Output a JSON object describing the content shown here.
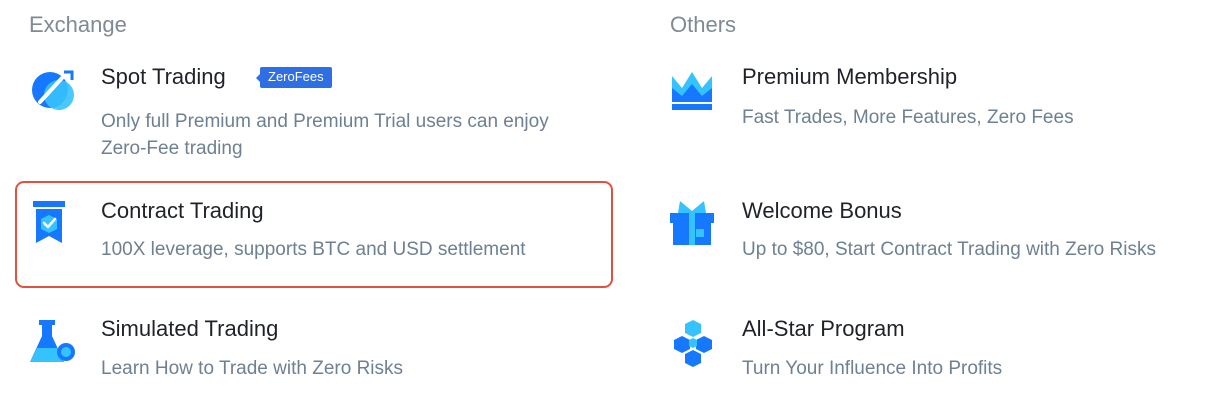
{
  "exchange": {
    "title": "Exchange",
    "items": [
      {
        "title": "Spot Trading",
        "badge": "ZeroFees",
        "description": "Only full Premium and Premium Trial users can enjoy Zero-Fee trading",
        "icon": "spot-trading-icon"
      },
      {
        "title": "Contract Trading",
        "description": "100X leverage, supports BTC and USD settlement",
        "icon": "contract-trading-icon"
      },
      {
        "title": "Simulated Trading",
        "description": "Learn How to Trade with Zero Risks",
        "icon": "flask-icon"
      }
    ]
  },
  "others": {
    "title": "Others",
    "items": [
      {
        "title": "Premium Membership",
        "description": "Fast Trades, More Features, Zero Fees",
        "icon": "crown-icon"
      },
      {
        "title": "Welcome Bonus",
        "description": "Up to $80, Start Contract Trading with Zero Risks",
        "icon": "gift-icon"
      },
      {
        "title": "All-Star Program",
        "description": "Turn Your Influence Into Profits",
        "icon": "hexagon-cluster-icon"
      }
    ]
  },
  "colors": {
    "brand_blue": "#2f6fe4",
    "highlight_border": "#e0523f",
    "title_text": "#1f2329",
    "description_text": "#6f8092",
    "section_title_text": "#7e8a96"
  }
}
